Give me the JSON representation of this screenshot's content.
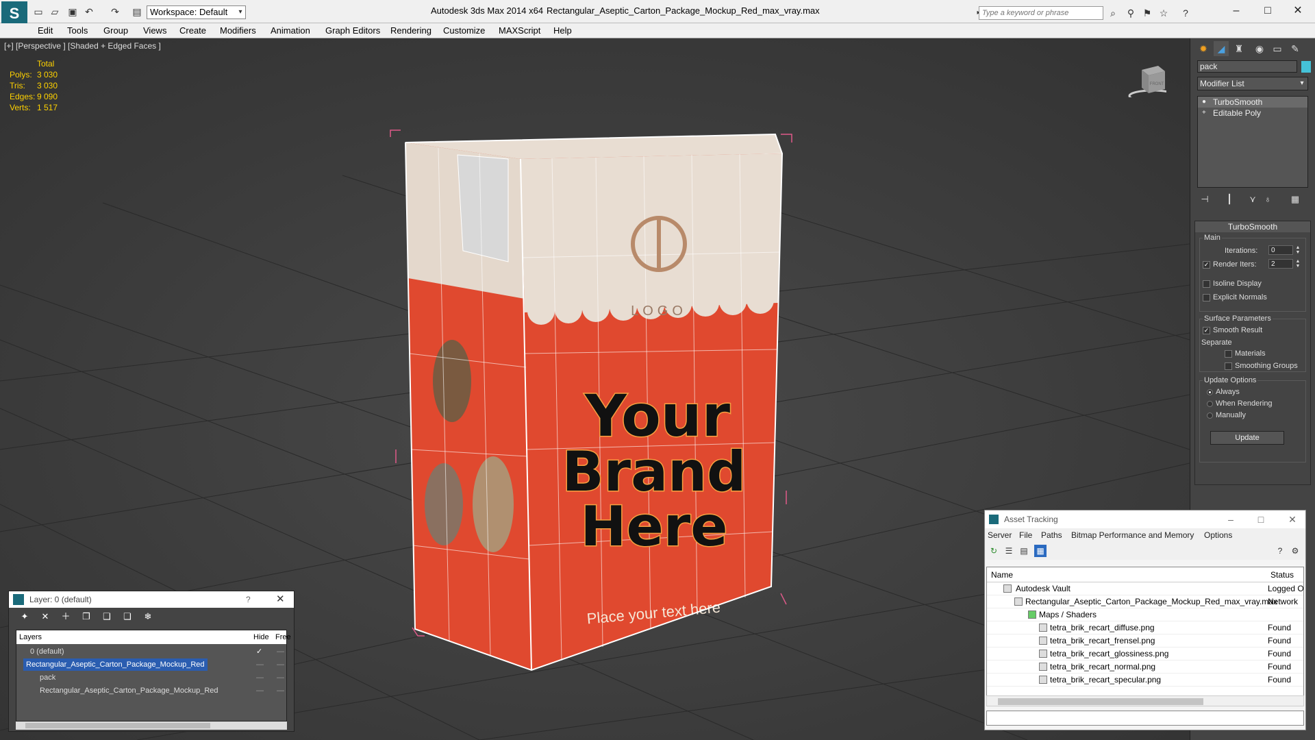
{
  "titlebar": {
    "app_title": "Autodesk 3ds Max  2014 x64",
    "file_name": "Rectangular_Aseptic_Carton_Package_Mockup_Red_max_vray.max",
    "workspace": "Workspace: Default",
    "search_placeholder": "Type a keyword or phrase"
  },
  "menu": [
    "Edit",
    "Tools",
    "Group",
    "Views",
    "Create",
    "Modifiers",
    "Animation",
    "Graph Editors",
    "Rendering",
    "Customize",
    "MAXScript",
    "Help"
  ],
  "viewport": {
    "label": "[+] [Perspective ] [Shaded + Edged Faces ]",
    "stats_total": "Total",
    "stats": [
      {
        "label": "Polys:",
        "value": "3 030"
      },
      {
        "label": "Tris:",
        "value": "3 030"
      },
      {
        "label": "Edges:",
        "value": "9 090"
      },
      {
        "label": "Verts:",
        "value": "1 517"
      }
    ],
    "carton": {
      "logo": "LOGO",
      "headline_1": "Your",
      "headline_2": "Brand",
      "headline_3": "Here",
      "tagline": "Place your text here",
      "color_front": "#e0492f",
      "color_top": "#e8ddd2"
    },
    "viewcube_label": "FRONT"
  },
  "command_panel": {
    "object_name": "pack",
    "object_color": "#45c2d8",
    "modifier_list": "Modifier List",
    "stack": [
      "TurboSmooth",
      "Editable Poly"
    ],
    "rollout_title": "TurboSmooth",
    "main_label": "Main",
    "iterations_label": "Iterations:",
    "iterations_value": "0",
    "render_iters_label": "Render Iters:",
    "render_iters_value": "2",
    "isoline_label": "Isoline Display",
    "explicit_normals_label": "Explicit Normals",
    "surface_params_label": "Surface Parameters",
    "smooth_result_label": "Smooth Result",
    "separate_label": "Separate",
    "materials_label": "Materials",
    "smoothing_groups_label": "Smoothing Groups",
    "update_options_label": "Update Options",
    "always_label": "Always",
    "when_rendering_label": "When Rendering",
    "manually_label": "Manually",
    "update_button": "Update"
  },
  "layer_dialog": {
    "title": "Layer: 0 (default)",
    "help": "?",
    "col_layers": "Layers",
    "col_hide": "Hide",
    "col_freeze": "Free",
    "rows": [
      {
        "name": "0 (default)"
      },
      {
        "name": "Rectangular_Aseptic_Carton_Package_Mockup_Red"
      },
      {
        "name": "pack"
      },
      {
        "name": "Rectangular_Aseptic_Carton_Package_Mockup_Red"
      }
    ]
  },
  "asset_dialog": {
    "title": "Asset Tracking",
    "menu": [
      "Server",
      "File",
      "Paths",
      "Bitmap Performance and Memory",
      "Options"
    ],
    "col_name": "Name",
    "col_status": "Status",
    "rows": [
      {
        "name": "Autodesk Vault",
        "status": "Logged O"
      },
      {
        "name": "Rectangular_Aseptic_Carton_Package_Mockup_Red_max_vray.max",
        "status": "Network"
      },
      {
        "name": "Maps / Shaders",
        "status": ""
      },
      {
        "name": "tetra_brik_recart_diffuse.png",
        "status": "Found"
      },
      {
        "name": "tetra_brik_recart_frensel.png",
        "status": "Found"
      },
      {
        "name": "tetra_brik_recart_glossiness.png",
        "status": "Found"
      },
      {
        "name": "tetra_brik_recart_normal.png",
        "status": "Found"
      },
      {
        "name": "tetra_brik_recart_specular.png",
        "status": "Found"
      }
    ]
  }
}
